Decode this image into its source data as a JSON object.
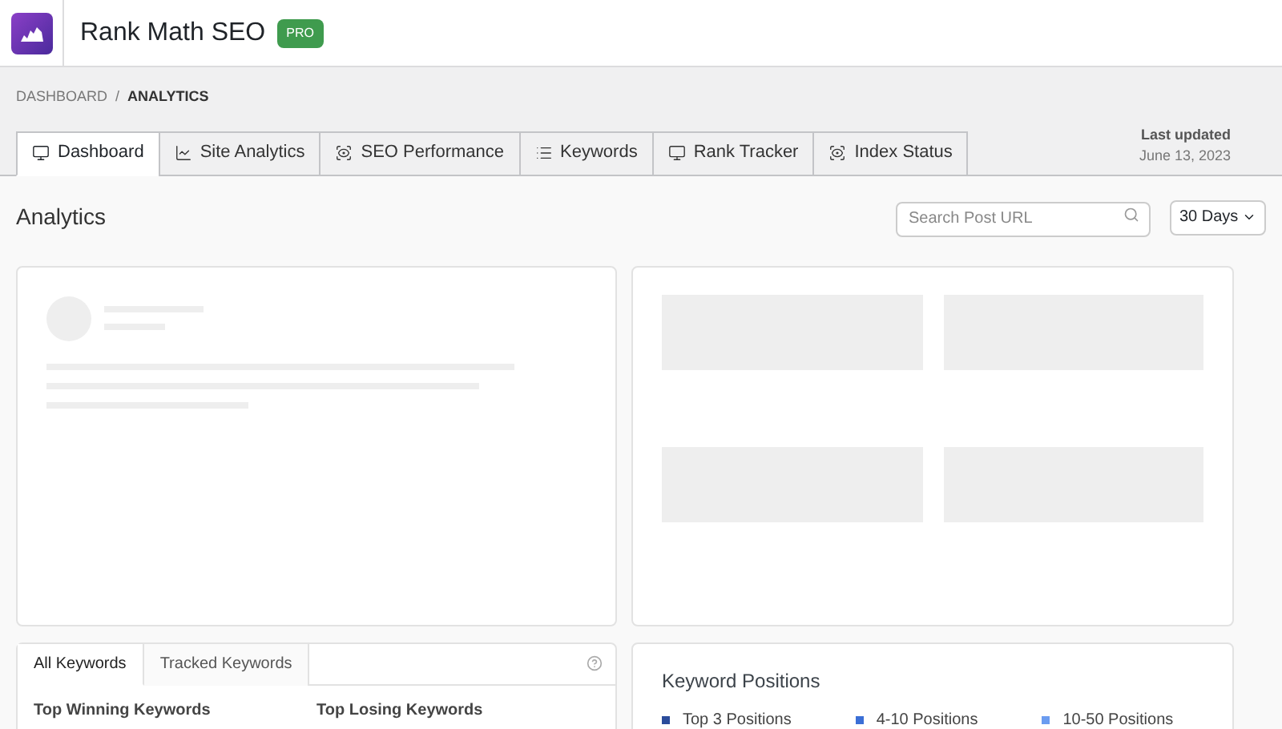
{
  "header": {
    "title": "Rank Math SEO",
    "badge": "PRO"
  },
  "breadcrumb": [
    "DASHBOARD",
    "/",
    "ANALYTICS"
  ],
  "tabs": [
    {
      "label": "Dashboard",
      "selected": true
    },
    {
      "label": "Site Analytics",
      "selected": false
    },
    {
      "label": "SEO Performance",
      "selected": false
    },
    {
      "label": "Keywords",
      "selected": false
    },
    {
      "label": "Rank Tracker",
      "selected": false
    },
    {
      "label": "Index Status",
      "selected": false
    }
  ],
  "last_updated": {
    "label": "Last updated",
    "date": "June 13, 2023"
  },
  "page_title": "Analytics",
  "search": {
    "placeholder": "Search Post URL"
  },
  "range": {
    "value": "30 Days"
  },
  "keywords_card": {
    "tabs": [
      {
        "label": "All Keywords",
        "selected": true
      },
      {
        "label": "Tracked Keywords",
        "selected": false
      }
    ],
    "columns": [
      "Top Winning Keywords",
      "Top Losing Keywords"
    ]
  },
  "positions_card": {
    "title": "Keyword Positions",
    "legend": [
      {
        "label": "Top 3 Positions",
        "color": "#2b4c9b"
      },
      {
        "label": "4-10 Positions",
        "color": "#3b6fd6"
      },
      {
        "label": "10-50 Positions",
        "color": "#6b9cf0"
      }
    ]
  }
}
